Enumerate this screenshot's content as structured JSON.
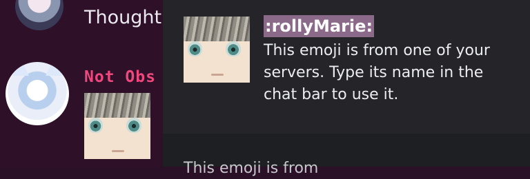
{
  "chat": {
    "messages": [
      {
        "text": "Thought"
      },
      {
        "username": "Not Obs"
      }
    ]
  },
  "emoji_popout": {
    "name": ":rollyMarie:",
    "description": "This emoji is from one of your servers. Type its name in the chat bar to use it.",
    "footer_partial": "This emoji is from"
  },
  "colors": {
    "chat_bg": "#2e1029",
    "popout_bg": "#242429",
    "popout_footer_bg": "#1e1f22",
    "username": "#f0477d",
    "name_highlight": "#8a6a88"
  },
  "icons": [
    "user-avatar",
    "user-avatar-fox",
    "rollymarie-emoji"
  ]
}
